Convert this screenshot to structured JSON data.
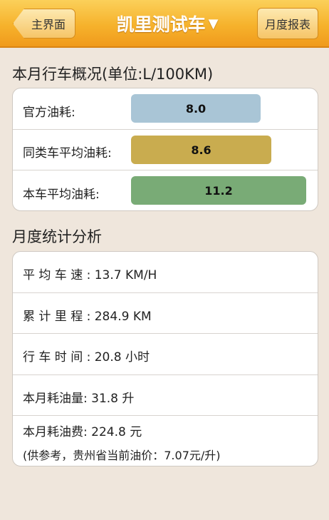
{
  "header": {
    "back_label": "主界面",
    "title": "凯里测试车",
    "title_arrow": "▼",
    "report_label": "月度报表",
    "colors": {
      "bar_top": "#fbd05a",
      "bar_bottom": "#f09a1c"
    }
  },
  "overview": {
    "title": "本月行车概况(单位:L/100KM)",
    "rows": [
      {
        "label": "官方油耗:",
        "value": "8.0",
        "fraction": 0.74,
        "color": "#a9c5d6"
      },
      {
        "label": "同类车平均油耗:",
        "value": "8.6",
        "fraction": 0.8,
        "color": "#c9ac4f"
      },
      {
        "label": "本车平均油耗:",
        "value": "11.2",
        "fraction": 1.0,
        "color": "#79ab76"
      }
    ]
  },
  "stats": {
    "title": "月度统计分析",
    "rows": [
      {
        "text": "平 均 车 速 : 13.7 KM/H"
      },
      {
        "text": "累 计 里 程 : 284.9 KM"
      },
      {
        "text": "行 车 时 间 : 20.8 小时"
      },
      {
        "text": "本月耗油量: 31.8 升"
      },
      {
        "text": "本月耗油费: 224.8 元",
        "note": "(供参考，贵州省当前油价：7.07元/升)"
      }
    ]
  }
}
